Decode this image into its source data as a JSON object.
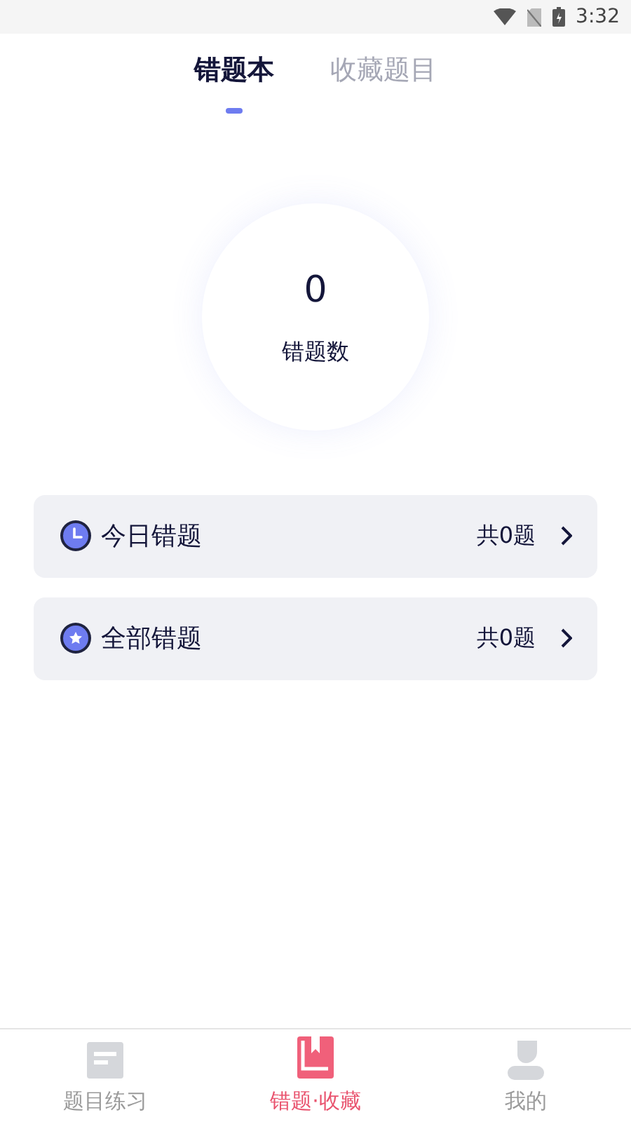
{
  "status_bar": {
    "time": "3:32"
  },
  "tabs": [
    {
      "label": "错题本",
      "selected": true
    },
    {
      "label": "收藏题目",
      "selected": false
    }
  ],
  "summary": {
    "count": "0",
    "label": "错题数"
  },
  "lists": [
    {
      "kind": "clock",
      "title": "今日错题",
      "total": "共0题"
    },
    {
      "kind": "star",
      "title": "全部错题",
      "total": "共0题"
    }
  ],
  "bottom_nav": [
    {
      "kind": "doc",
      "label": "题目练习",
      "selected": false
    },
    {
      "kind": "book",
      "label": "错题·收藏",
      "selected": true
    },
    {
      "kind": "person",
      "label": "我的",
      "selected": false
    }
  ]
}
